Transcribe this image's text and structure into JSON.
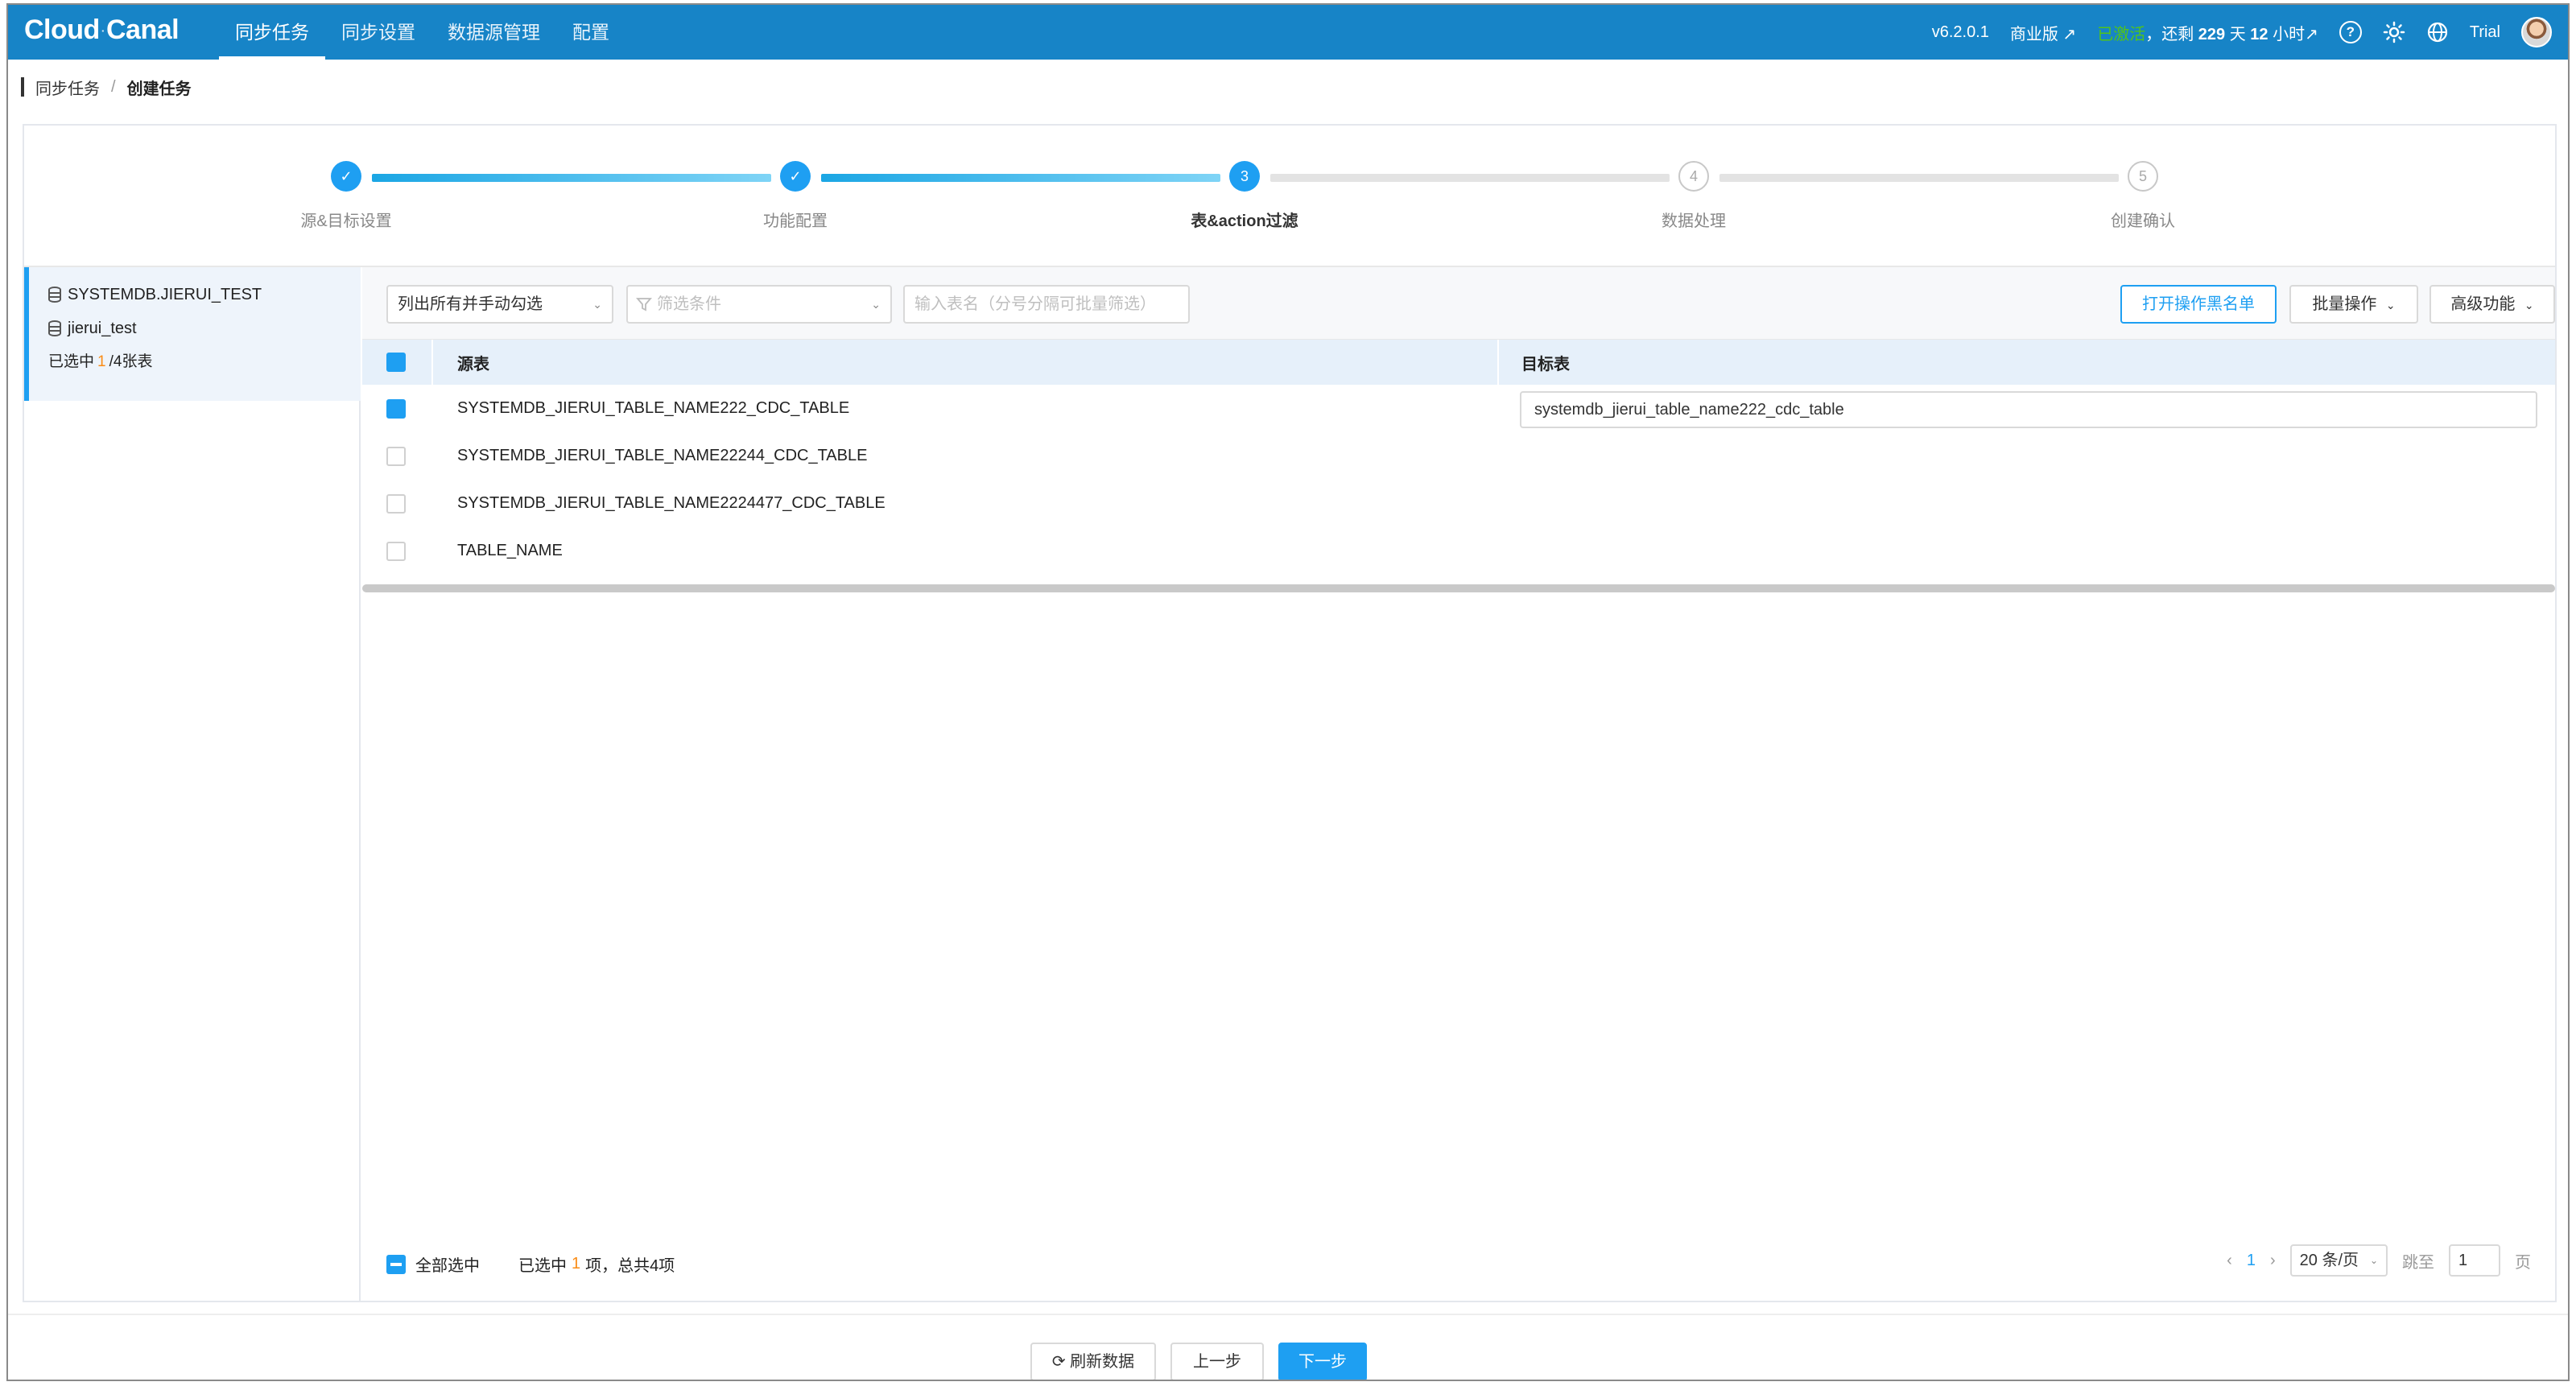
{
  "app": {
    "logo": "Cloud",
    "logo_sep": "·",
    "logo_tail": "Canal"
  },
  "nav": {
    "items": [
      {
        "label": "同步任务",
        "active": true
      },
      {
        "label": "同步设置"
      },
      {
        "label": "数据源管理"
      },
      {
        "label": "配置"
      }
    ]
  },
  "topbar": {
    "version": "v6.2.0.1",
    "edition": "商业版 ↗",
    "activated": "已激活",
    "remaining_prefix": "，还剩",
    "remaining_days": "229",
    "remaining_days_unit": "天",
    "remaining_hours": "12",
    "remaining_hours_unit": "小时↗",
    "help_icon": "?",
    "user": "Trial",
    "brand_color": "#1784c7"
  },
  "breadcrumb": {
    "parent": "同步任务",
    "sep": "/",
    "current": "创建任务"
  },
  "steps": [
    {
      "label": "源&目标设置",
      "state": "done",
      "mark": "✓"
    },
    {
      "label": "功能配置",
      "state": "done",
      "mark": "✓"
    },
    {
      "label": "表&action过滤",
      "state": "current",
      "mark": "3"
    },
    {
      "label": "数据处理",
      "state": "todo",
      "mark": "4"
    },
    {
      "label": "创建确认",
      "state": "todo",
      "mark": "5"
    }
  ],
  "left_panel": {
    "source_db": "SYSTEMDB.JIERUI_TEST",
    "target_db": "jierui_test",
    "selected_prefix": "已选中",
    "selected_count": "1",
    "selected_suffix": "/4张表"
  },
  "toolbar": {
    "mode_select": "列出所有并手动勾选",
    "filter_select": "筛选条件",
    "table_search_placeholder": "输入表名（分号分隔可批量筛选）",
    "blacklist_button": "打开操作黑名单",
    "batch_button": "批量操作",
    "advanced_button": "高级功能"
  },
  "table": {
    "col_source": "源表",
    "col_target": "目标表",
    "rows": [
      {
        "source": "SYSTEMDB_JIERUI_TABLE_NAME222_CDC_TABLE",
        "checked": true,
        "target": "systemdb_jierui_table_name222_cdc_table"
      },
      {
        "source": "SYSTEMDB_JIERUI_TABLE_NAME22244_CDC_TABLE",
        "checked": false,
        "target": ""
      },
      {
        "source": "SYSTEMDB_JIERUI_TABLE_NAME2224477_CDC_TABLE",
        "checked": false,
        "target": ""
      },
      {
        "source": "TABLE_NAME",
        "checked": false,
        "target": ""
      }
    ]
  },
  "footer": {
    "select_all": "全部选中",
    "selected_prefix": "已选中",
    "selected_count": "1",
    "selected_suffix": "项，总共4项",
    "page_prev": "‹",
    "page_current": "1",
    "page_next": "›",
    "page_size": "20 条/页",
    "jump_label": "跳至",
    "jump_value": "1",
    "page_unit": "页"
  },
  "bottom": {
    "refresh": "⟳ 刷新数据",
    "prev": "上一步",
    "next": "下一步"
  }
}
